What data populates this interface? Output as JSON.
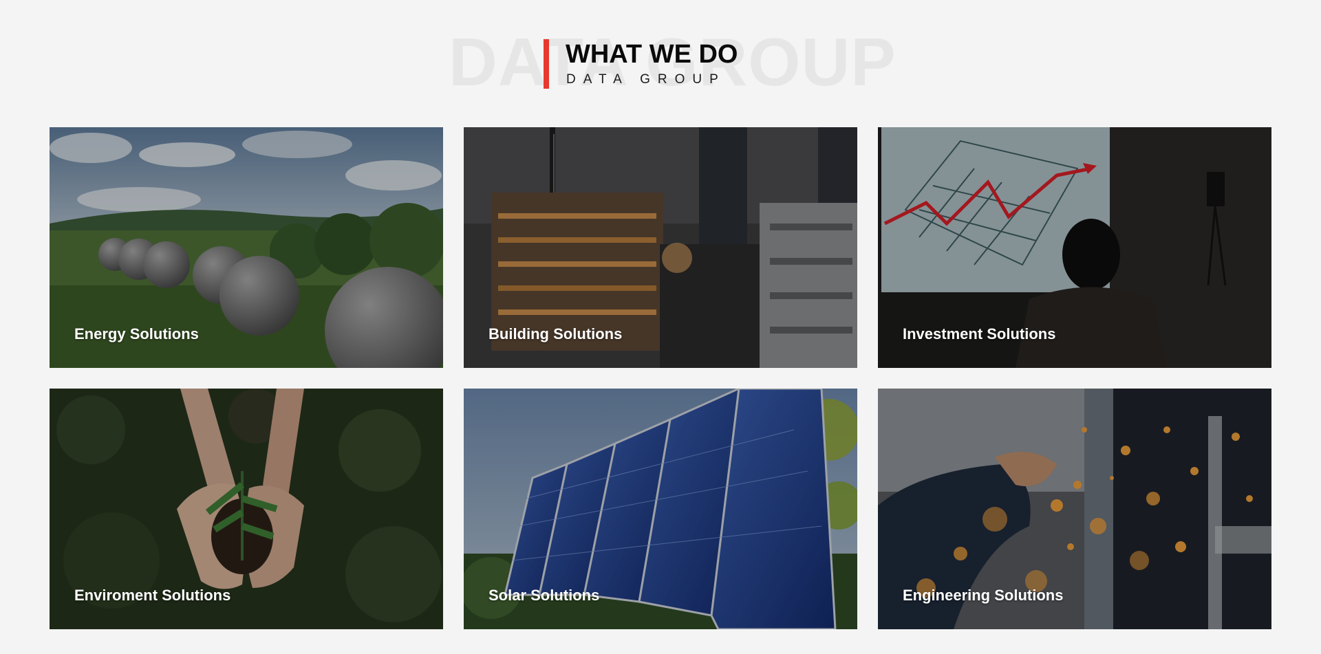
{
  "section": {
    "watermark": "DATA GROUP",
    "title": "WHAT WE DO",
    "subtitle": "DATA GROUP",
    "accent_color": "#e8392e"
  },
  "cards": [
    {
      "title": "Energy Solutions",
      "image": "gas-storage-spheres-photo"
    },
    {
      "title": "Building Solutions",
      "image": "construction-building-night-photo"
    },
    {
      "title": "Investment Solutions",
      "image": "growth-chart-presentation-photo"
    },
    {
      "title": "Enviroment Solutions",
      "image": "hands-holding-plant-soil-photo"
    },
    {
      "title": "Solar Solutions",
      "image": "solar-panels-photo"
    },
    {
      "title": "Engineering Solutions",
      "image": "welding-sparks-photo"
    }
  ]
}
